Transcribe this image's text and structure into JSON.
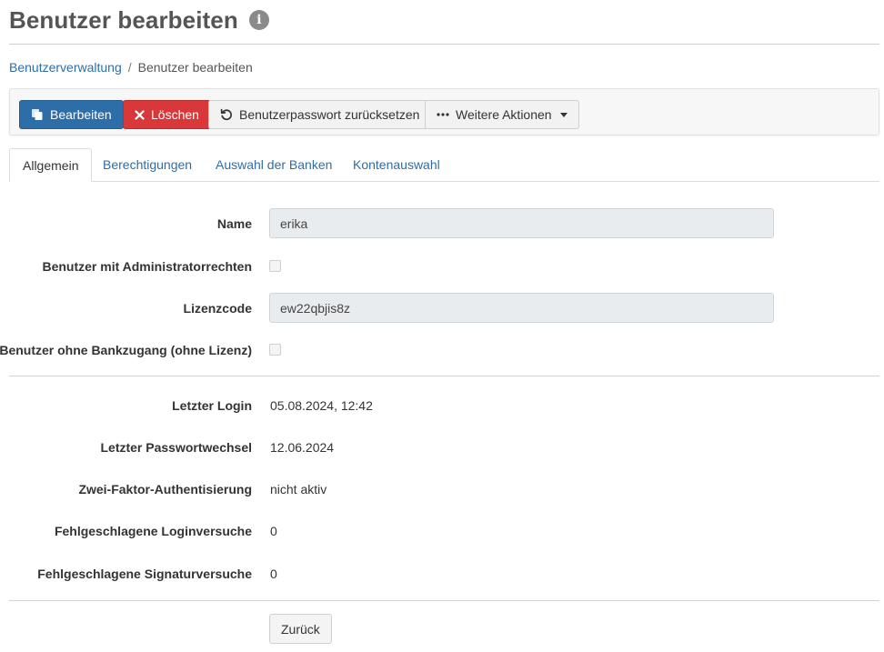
{
  "page": {
    "title": "Benutzer bearbeiten"
  },
  "breadcrumb": {
    "parent": "Benutzerverwaltung",
    "separator": "/",
    "current": "Benutzer bearbeiten"
  },
  "toolbar": {
    "edit_label": "Bearbeiten",
    "delete_label": "Löschen",
    "reset_password_label": "Benutzerpasswort zurücksetzen",
    "more_actions_label": "Weitere Aktionen"
  },
  "tabs": [
    {
      "label": "Allgemein",
      "active": true
    },
    {
      "label": "Berechtigungen",
      "active": false
    },
    {
      "label": "Auswahl der Banken",
      "active": false
    },
    {
      "label": "Kontenauswahl",
      "active": false
    }
  ],
  "form": {
    "name": {
      "label": "Name",
      "value": "erika"
    },
    "admin": {
      "label": "Benutzer mit Administratorrechten",
      "checked": false
    },
    "license": {
      "label": "Lizenzcode",
      "value": "ew22qbjis8z"
    },
    "no_bank_access": {
      "label": "Benutzer ohne Bankzugang (ohne Lizenz)",
      "checked": false
    }
  },
  "details": {
    "last_login": {
      "label": "Letzter Login",
      "value": "05.08.2024, 12:42"
    },
    "last_password_change": {
      "label": "Letzter Passwortwechsel",
      "value": "12.06.2024"
    },
    "two_factor": {
      "label": "Zwei-Faktor-Authentisierung",
      "value": "nicht aktiv"
    },
    "failed_logins": {
      "label": "Fehlgeschlagene Loginversuche",
      "value": "0"
    },
    "failed_signatures": {
      "label": "Fehlgeschlagene Signaturversuche",
      "value": "0"
    }
  },
  "footer": {
    "back_label": "Zurück"
  },
  "colors": {
    "primary": "#2d6ea8",
    "danger": "#d9383a",
    "link": "#2d6ea8"
  }
}
